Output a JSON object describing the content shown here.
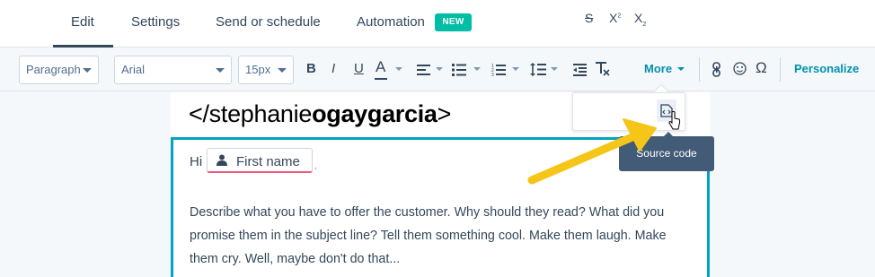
{
  "tabs": {
    "edit": "Edit",
    "settings": "Settings",
    "send": "Send or schedule",
    "automation": "Automation",
    "automation_badge": "NEW"
  },
  "toolbar": {
    "paragraph": "Paragraph",
    "font": "Arial",
    "size": "15px",
    "bold": "B",
    "italic": "I",
    "underline": "U",
    "font_color": "A",
    "more": "More",
    "personalize": "Personalize",
    "strike": "S",
    "superscript": "X",
    "subscript": "X"
  },
  "tooltip": "Source code",
  "editor": {
    "logo_light": "</stephanie",
    "logo_bold": "ogaygarcia",
    "logo_end": ">",
    "greeting": "Hi",
    "token": "First name",
    "token_trail": ",",
    "body": "Describe what you have to offer the customer. Why should they read? What did you promise them in the subject line? Tell them something cool. Make them laugh. Make them cry. Well, maybe don't do that..."
  },
  "colors": {
    "accent": "#0091ae",
    "badge": "#00bda5",
    "tooltip": "#425b76",
    "arrow": "#f5c518",
    "selection": "#00a4bd"
  },
  "icons": {
    "align": "align-left-icon",
    "bullets": "bulleted-list-icon",
    "numbers": "numbered-list-icon",
    "line_height": "line-height-icon",
    "outdent": "outdent-icon",
    "clear": "clear-format-icon",
    "link": "link-icon",
    "emoji": "emoji-icon",
    "symbol": "omega-icon",
    "source": "source-code-icon",
    "user": "user-icon",
    "cursor": "pointer-cursor-icon"
  }
}
